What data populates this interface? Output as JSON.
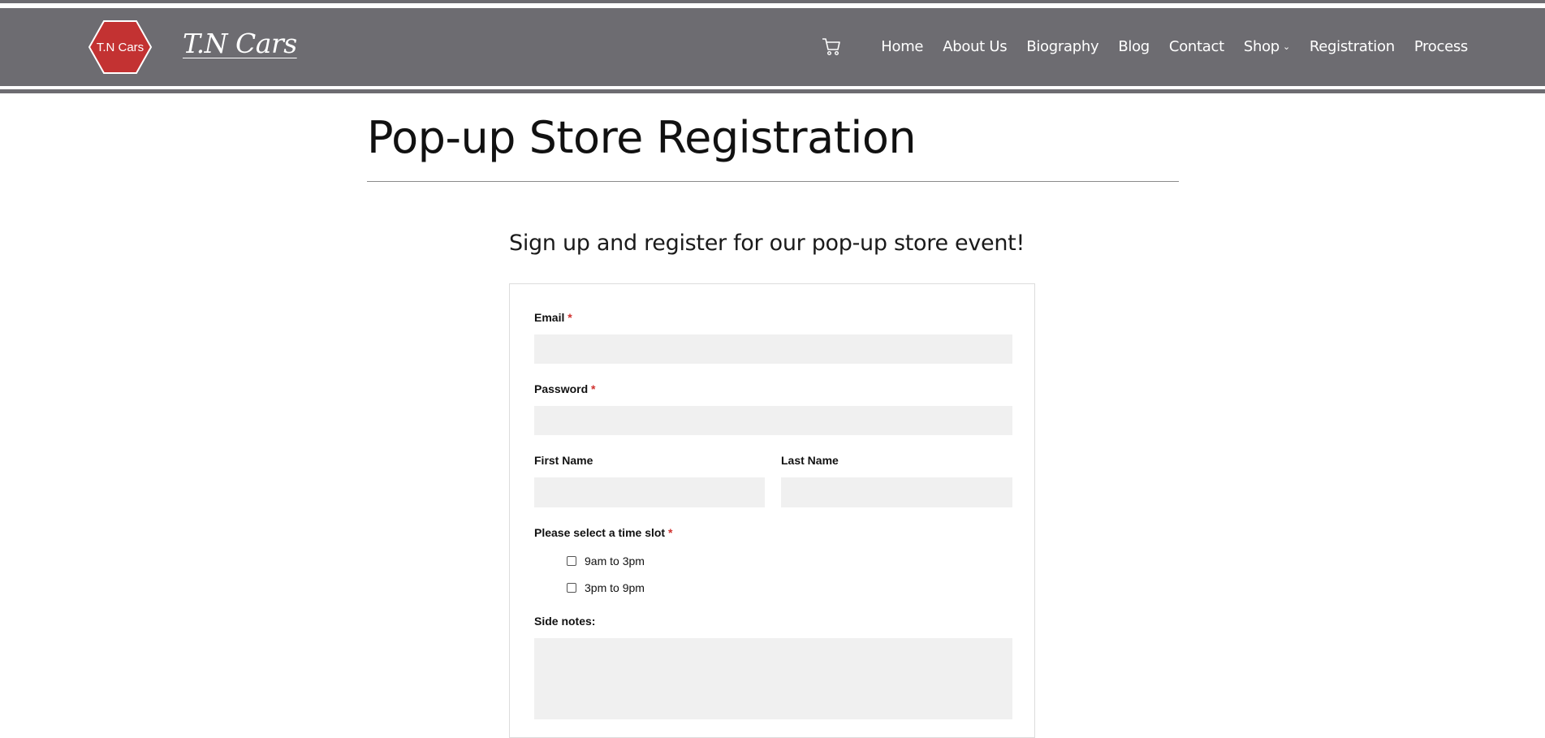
{
  "header": {
    "logo_text": "T.N Cars",
    "site_title": "T.N Cars",
    "nav": [
      {
        "label": "Home"
      },
      {
        "label": "About Us"
      },
      {
        "label": "Biography"
      },
      {
        "label": "Blog"
      },
      {
        "label": "Contact"
      },
      {
        "label": "Shop"
      },
      {
        "label": "Registration"
      },
      {
        "label": "Process"
      }
    ],
    "cart_icon": "shopping-cart-icon"
  },
  "main": {
    "title": "Pop-up Store Registration",
    "subtitle": "Sign up and register for our pop-up store event!"
  },
  "form": {
    "email_label": "Email",
    "email_value": "",
    "password_label": "Password",
    "password_value": "",
    "first_name_label": "First Name",
    "first_name_value": "",
    "last_name_label": "Last Name",
    "last_name_value": "",
    "time_slot_label": "Please select a time slot",
    "time_slots": [
      {
        "label": "9am to 3pm",
        "checked": false
      },
      {
        "label": "3pm to 9pm",
        "checked": false
      }
    ],
    "side_notes_label": "Side notes:",
    "side_notes_value": "",
    "required_mark": "*"
  },
  "colors": {
    "header_bg": "#6d6c71",
    "logo_red": "#c33232",
    "required": "#d0322f",
    "field_bg": "#f0f0f0"
  }
}
